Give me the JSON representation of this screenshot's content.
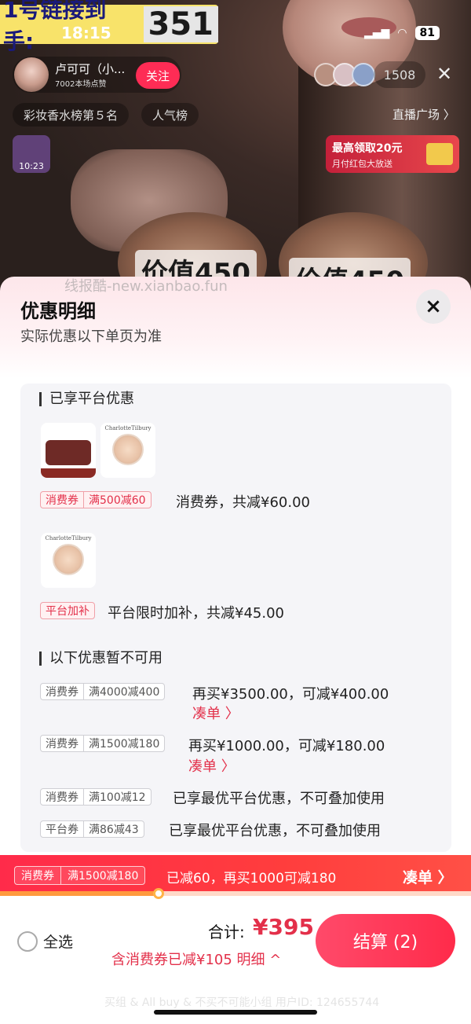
{
  "live": {
    "banner_text": "1号链接到手:",
    "banner_number": "351",
    "status_time": "18:15",
    "battery": "81",
    "anchor_name": "卢可可（小...",
    "anchor_sub": "7002本场点赞",
    "follow_label": "关注",
    "viewer_count": "1508",
    "rank_chip": "彩妆香水榜第５名",
    "popular_chip": "人气榜",
    "plaza_link": "直播广场 〉",
    "clock_time": "10:23",
    "redpacket_title": "最高领取20元",
    "redpacket_sub": "月付红包大放送",
    "product_label": "价值450"
  },
  "watermark": "线报酷-new.xianbao.fun",
  "panel": {
    "title": "优惠明细",
    "subtitle": "实际优惠以下单页为准",
    "close_icon": "×"
  },
  "enjoyed": {
    "heading": "已享平台优惠",
    "thumb_brand": "CharlotteTilbury",
    "coupon1": {
      "type": "消费券",
      "rule": "满500减60",
      "desc": "消费券，共减¥60.00"
    },
    "coupon2": {
      "type": "平台加补",
      "desc": "平台限时加补，共减¥45.00"
    }
  },
  "unavailable": {
    "heading": "以下优惠暂不可用",
    "items": [
      {
        "type": "消费券",
        "rule": "满4000减400",
        "desc": "再买¥3500.00，可减¥400.00",
        "link": "凑单 〉"
      },
      {
        "type": "消费券",
        "rule": "满1500减180",
        "desc": "再买¥1000.00，可减¥180.00",
        "link": "凑单 〉"
      },
      {
        "type": "消费券",
        "rule": "满100减12",
        "desc": "已享最优平台优惠，不可叠加使用"
      },
      {
        "type": "平台券",
        "rule": "满86减43",
        "desc": "已享最优平台优惠，不可叠加使用"
      }
    ]
  },
  "promo": {
    "type": "消费券",
    "rule": "满1500减180",
    "text": "已减60，再买1000可减180",
    "link": "凑单 〉",
    "progress": 0.34
  },
  "checkout_bar": {
    "select_all": "全选",
    "total_label": "合计:",
    "total_value": "¥395",
    "saved_text": "含消费券已减¥105 明细 ^",
    "checkout_label": "结算 (2)"
  },
  "footer_text": "买组 & All buy & 不买不可能小组   用户ID: 124655744",
  "colors": {
    "accent": "#fe2c55",
    "price": "#e3304a"
  }
}
